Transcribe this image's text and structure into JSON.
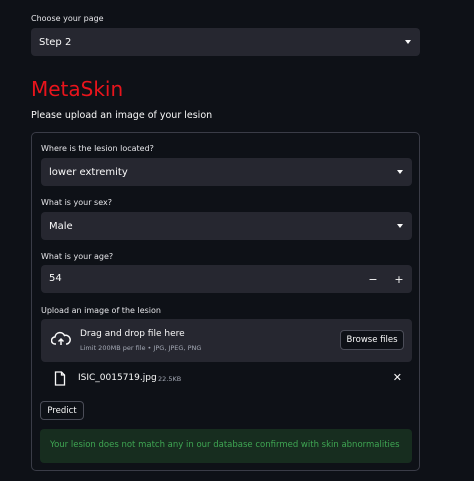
{
  "page_chooser": {
    "label": "Choose your page",
    "value": "Step 2"
  },
  "app": {
    "title": "MetaSkin",
    "subtitle": "Please upload an image of your lesion"
  },
  "form": {
    "location": {
      "label": "Where is the lesion located?",
      "value": "lower extremity"
    },
    "sex": {
      "label": "What is your sex?",
      "value": "Male"
    },
    "age": {
      "label": "What is your age?",
      "value": "54",
      "minus": "−",
      "plus": "+"
    },
    "upload": {
      "label": "Upload an image of the lesion",
      "drop_text": "Drag and drop file here",
      "limit_text": "Limit 200MB per file • JPG, JPEG, PNG",
      "browse_label": "Browse files",
      "file": {
        "name": "ISIC_0015719.jpg",
        "size": "22.5KB",
        "remove_icon": "close-icon"
      }
    },
    "predict_label": "Predict",
    "result_message": "Your lesion does not match any in our database confirmed with skin abnormalities"
  },
  "colors": {
    "background": "#0e1117",
    "widget": "#262730",
    "title": "#e8141c",
    "success_text": "#3fa653",
    "success_bg": "#172d1f"
  }
}
